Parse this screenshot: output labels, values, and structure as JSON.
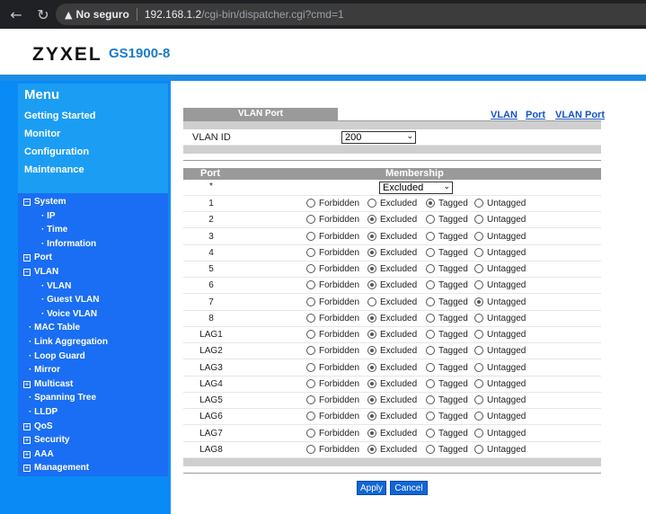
{
  "browser": {
    "security_label": "No seguro",
    "url_host": "192.168.1.2",
    "url_path": "/cgi-bin/dispatcher.cgi?cmd=1"
  },
  "header": {
    "brand": "ZYXEL",
    "model": "GS1900-8"
  },
  "menu": {
    "title": "Menu",
    "items": [
      "Getting Started",
      "Monitor",
      "Configuration",
      "Maintenance"
    ]
  },
  "tree": [
    {
      "label": "System",
      "prefix": "minus",
      "level": 0
    },
    {
      "label": "IP",
      "prefix": "dot",
      "level": 2
    },
    {
      "label": "Time",
      "prefix": "dot",
      "level": 2
    },
    {
      "label": "Information",
      "prefix": "dot",
      "level": 2
    },
    {
      "label": "Port",
      "prefix": "plus",
      "level": 0
    },
    {
      "label": "VLAN",
      "prefix": "minus",
      "level": 0
    },
    {
      "label": "VLAN",
      "prefix": "dot",
      "level": 2
    },
    {
      "label": "Guest VLAN",
      "prefix": "dot",
      "level": 2
    },
    {
      "label": "Voice VLAN",
      "prefix": "dot",
      "level": 2
    },
    {
      "label": "MAC Table",
      "prefix": "dot",
      "level": 1
    },
    {
      "label": "Link Aggregation",
      "prefix": "dot",
      "level": 1
    },
    {
      "label": "Loop Guard",
      "prefix": "dot",
      "level": 1
    },
    {
      "label": "Mirror",
      "prefix": "dot",
      "level": 1
    },
    {
      "label": "Multicast",
      "prefix": "plus",
      "level": 0
    },
    {
      "label": "Spanning Tree",
      "prefix": "dot",
      "level": 1
    },
    {
      "label": "LLDP",
      "prefix": "dot",
      "level": 1
    },
    {
      "label": "QoS",
      "prefix": "plus",
      "level": 0
    },
    {
      "label": "Security",
      "prefix": "plus",
      "level": 0
    },
    {
      "label": "AAA",
      "prefix": "plus",
      "level": 0
    },
    {
      "label": "Management",
      "prefix": "plus",
      "level": 0
    }
  ],
  "breadcrumbs": [
    "VLAN",
    "Port",
    "VLAN Port"
  ],
  "section_tab": "VLAN Port",
  "vlan_id": {
    "label": "VLAN ID",
    "value": "200"
  },
  "table": {
    "col_port": "Port",
    "col_membership": "Membership",
    "all_row": {
      "port": "*",
      "selected": "Excluded"
    },
    "options": [
      "Forbidden",
      "Excluded",
      "Tagged",
      "Untagged"
    ],
    "rows": [
      {
        "port": "1",
        "selected": "Tagged"
      },
      {
        "port": "2",
        "selected": "Excluded"
      },
      {
        "port": "3",
        "selected": "Excluded"
      },
      {
        "port": "4",
        "selected": "Excluded"
      },
      {
        "port": "5",
        "selected": "Excluded"
      },
      {
        "port": "6",
        "selected": "Excluded"
      },
      {
        "port": "7",
        "selected": "Untagged"
      },
      {
        "port": "8",
        "selected": "Excluded"
      },
      {
        "port": "LAG1",
        "selected": "Excluded"
      },
      {
        "port": "LAG2",
        "selected": "Excluded"
      },
      {
        "port": "LAG3",
        "selected": "Excluded"
      },
      {
        "port": "LAG4",
        "selected": "Excluded"
      },
      {
        "port": "LAG5",
        "selected": "Excluded"
      },
      {
        "port": "LAG6",
        "selected": "Excluded"
      },
      {
        "port": "LAG7",
        "selected": "Excluded"
      },
      {
        "port": "LAG8",
        "selected": "Excluded"
      }
    ]
  },
  "buttons": {
    "apply": "Apply",
    "cancel": "Cancel"
  },
  "icons": {
    "back": "arrow-left-icon",
    "reload": "reload-icon",
    "warning": "warning-icon",
    "cursor": "mouse-pointer-icon"
  }
}
